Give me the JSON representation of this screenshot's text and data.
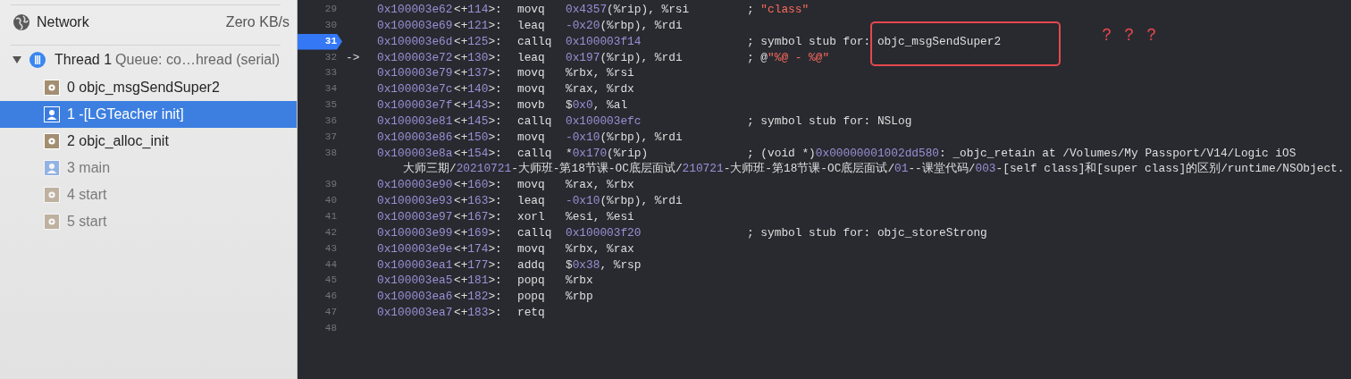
{
  "sidebar": {
    "network": {
      "label": "Network",
      "value": "Zero KB/s"
    },
    "thread": {
      "expanded": true,
      "name": "Thread 1",
      "queue": "Queue: co…hread (serial)",
      "frames": [
        {
          "label": "0 objc_msgSendSuper2",
          "kind": "library",
          "dimmed": false,
          "selected": false
        },
        {
          "label": "1 -[LGTeacher init]",
          "kind": "user",
          "dimmed": false,
          "selected": true
        },
        {
          "label": "2 objc_alloc_init",
          "kind": "library",
          "dimmed": false,
          "selected": false
        },
        {
          "label": "3 main",
          "kind": "user",
          "dimmed": true,
          "selected": false
        },
        {
          "label": "4 start",
          "kind": "library",
          "dimmed": true,
          "selected": false
        },
        {
          "label": "5 start",
          "kind": "library",
          "dimmed": true,
          "selected": false
        }
      ]
    }
  },
  "disassembly": {
    "lines": [
      {
        "num": "29",
        "breakpoint": false,
        "address": "0x100003e62",
        "offset": [
          {
            "text": "<+",
            "kind": "plain"
          },
          {
            "text": "114",
            "kind": "num"
          },
          {
            "text": ">:",
            "kind": "plain"
          }
        ],
        "mnemonic": "movq",
        "operand": [
          {
            "text": "0x4357",
            "kind": "num"
          },
          {
            "text": "(%rip), %rsi",
            "kind": "plain"
          }
        ],
        "comment": [
          {
            "text": "; ",
            "kind": "plain"
          },
          {
            "text": "\"class\"",
            "kind": "str"
          }
        ]
      },
      {
        "num": "30",
        "breakpoint": false,
        "address": "0x100003e69",
        "offset": [
          {
            "text": "<+",
            "kind": "plain"
          },
          {
            "text": "121",
            "kind": "num"
          },
          {
            "text": ">:",
            "kind": "plain"
          }
        ],
        "mnemonic": "leaq",
        "operand": [
          {
            "text": "-0x20",
            "kind": "num"
          },
          {
            "text": "(%rbp), %rdi",
            "kind": "plain"
          }
        ]
      },
      {
        "num": "31",
        "breakpoint": true,
        "address": "0x100003e6d",
        "offset": [
          {
            "text": "<+",
            "kind": "plain"
          },
          {
            "text": "125",
            "kind": "num"
          },
          {
            "text": ">:",
            "kind": "plain"
          }
        ],
        "mnemonic": "callq",
        "operand": [
          {
            "text": "0x100003f14",
            "kind": "num"
          }
        ],
        "comment": [
          {
            "text": "; symbol stub for: objc_msgSendSuper2",
            "kind": "plain"
          }
        ]
      },
      {
        "num": "32",
        "breakpoint": false,
        "arrow": "->",
        "address": "0x100003e72",
        "offset": [
          {
            "text": "<+",
            "kind": "plain"
          },
          {
            "text": "130",
            "kind": "num"
          },
          {
            "text": ">:",
            "kind": "plain"
          }
        ],
        "mnemonic": "leaq",
        "operand": [
          {
            "text": "0x197",
            "kind": "num"
          },
          {
            "text": "(%rip), %rdi",
            "kind": "plain"
          }
        ],
        "comment": [
          {
            "text": "; @",
            "kind": "plain"
          },
          {
            "text": "\"%@ - %@\"",
            "kind": "str"
          }
        ]
      },
      {
        "num": "33",
        "breakpoint": false,
        "address": "0x100003e79",
        "offset": [
          {
            "text": "<+",
            "kind": "plain"
          },
          {
            "text": "137",
            "kind": "num"
          },
          {
            "text": ">:",
            "kind": "plain"
          }
        ],
        "mnemonic": "movq",
        "operand": [
          {
            "text": "%rbx, %rsi",
            "kind": "plain"
          }
        ]
      },
      {
        "num": "34",
        "breakpoint": false,
        "address": "0x100003e7c",
        "offset": [
          {
            "text": "<+",
            "kind": "plain"
          },
          {
            "text": "140",
            "kind": "num"
          },
          {
            "text": ">:",
            "kind": "plain"
          }
        ],
        "mnemonic": "movq",
        "operand": [
          {
            "text": "%rax, %rdx",
            "kind": "plain"
          }
        ]
      },
      {
        "num": "35",
        "breakpoint": false,
        "address": "0x100003e7f",
        "offset": [
          {
            "text": "<+",
            "kind": "plain"
          },
          {
            "text": "143",
            "kind": "num"
          },
          {
            "text": ">:",
            "kind": "plain"
          }
        ],
        "mnemonic": "movb",
        "operand": [
          {
            "text": "$",
            "kind": "plain"
          },
          {
            "text": "0x0",
            "kind": "num"
          },
          {
            "text": ", %al",
            "kind": "plain"
          }
        ]
      },
      {
        "num": "36",
        "breakpoint": false,
        "address": "0x100003e81",
        "offset": [
          {
            "text": "<+",
            "kind": "plain"
          },
          {
            "text": "145",
            "kind": "num"
          },
          {
            "text": ">:",
            "kind": "plain"
          }
        ],
        "mnemonic": "callq",
        "operand": [
          {
            "text": "0x100003efc",
            "kind": "num"
          }
        ],
        "comment": [
          {
            "text": "; symbol stub for: NSLog",
            "kind": "plain"
          }
        ]
      },
      {
        "num": "37",
        "breakpoint": false,
        "address": "0x100003e86",
        "offset": [
          {
            "text": "<+",
            "kind": "plain"
          },
          {
            "text": "150",
            "kind": "num"
          },
          {
            "text": ">:",
            "kind": "plain"
          }
        ],
        "mnemonic": "movq",
        "operand": [
          {
            "text": "-0x10",
            "kind": "num"
          },
          {
            "text": "(%rbp), %rdi",
            "kind": "plain"
          }
        ]
      },
      {
        "num": "38",
        "breakpoint": false,
        "address": "0x100003e8a",
        "offset": [
          {
            "text": "<+",
            "kind": "plain"
          },
          {
            "text": "154",
            "kind": "num"
          },
          {
            "text": ">:",
            "kind": "plain"
          }
        ],
        "mnemonic": "callq",
        "operand": [
          {
            "text": "*",
            "kind": "plain"
          },
          {
            "text": "0x170",
            "kind": "num"
          },
          {
            "text": "(%rip)",
            "kind": "plain"
          }
        ],
        "comment": [
          {
            "text": "; (void *)",
            "kind": "plain"
          },
          {
            "text": "0x00000001002dd580",
            "kind": "num"
          },
          {
            "text": ": _objc_retain at /Volumes/My Passport/V14/Logic iOS",
            "kind": "plain"
          }
        ],
        "continuation": [
          {
            "text": "大师三期/",
            "kind": "plain"
          },
          {
            "text": "20210721",
            "kind": "num"
          },
          {
            "text": "-大师班-第18节课-OC底层面试/",
            "kind": "plain"
          },
          {
            "text": "210721",
            "kind": "num"
          },
          {
            "text": "-大师班-第18节课-OC底层面试/",
            "kind": "plain"
          },
          {
            "text": "01",
            "kind": "num"
          },
          {
            "text": "--课堂代码/",
            "kind": "plain"
          },
          {
            "text": "003",
            "kind": "num"
          },
          {
            "text": "-[self class]和[super class]的区别/runtime/NSObject.",
            "kind": "plain"
          }
        ]
      },
      {
        "num": "39",
        "breakpoint": false,
        "address": "0x100003e90",
        "offset": [
          {
            "text": "<+",
            "kind": "plain"
          },
          {
            "text": "160",
            "kind": "num"
          },
          {
            "text": ">:",
            "kind": "plain"
          }
        ],
        "mnemonic": "movq",
        "operand": [
          {
            "text": "%rax, %rbx",
            "kind": "plain"
          }
        ]
      },
      {
        "num": "40",
        "breakpoint": false,
        "address": "0x100003e93",
        "offset": [
          {
            "text": "<+",
            "kind": "plain"
          },
          {
            "text": "163",
            "kind": "num"
          },
          {
            "text": ">:",
            "kind": "plain"
          }
        ],
        "mnemonic": "leaq",
        "operand": [
          {
            "text": "-0x10",
            "kind": "num"
          },
          {
            "text": "(%rbp), %rdi",
            "kind": "plain"
          }
        ]
      },
      {
        "num": "41",
        "breakpoint": false,
        "address": "0x100003e97",
        "offset": [
          {
            "text": "<+",
            "kind": "plain"
          },
          {
            "text": "167",
            "kind": "num"
          },
          {
            "text": ">:",
            "kind": "plain"
          }
        ],
        "mnemonic": "xorl",
        "operand": [
          {
            "text": "%esi, %esi",
            "kind": "plain"
          }
        ]
      },
      {
        "num": "42",
        "breakpoint": false,
        "address": "0x100003e99",
        "offset": [
          {
            "text": "<+",
            "kind": "plain"
          },
          {
            "text": "169",
            "kind": "num"
          },
          {
            "text": ">:",
            "kind": "plain"
          }
        ],
        "mnemonic": "callq",
        "operand": [
          {
            "text": "0x100003f20",
            "kind": "num"
          }
        ],
        "comment": [
          {
            "text": "; symbol stub for: objc_storeStrong",
            "kind": "plain"
          }
        ]
      },
      {
        "num": "43",
        "breakpoint": false,
        "address": "0x100003e9e",
        "offset": [
          {
            "text": "<+",
            "kind": "plain"
          },
          {
            "text": "174",
            "kind": "num"
          },
          {
            "text": ">:",
            "kind": "plain"
          }
        ],
        "mnemonic": "movq",
        "operand": [
          {
            "text": "%rbx, %rax",
            "kind": "plain"
          }
        ]
      },
      {
        "num": "44",
        "breakpoint": false,
        "address": "0x100003ea1",
        "offset": [
          {
            "text": "<+",
            "kind": "plain"
          },
          {
            "text": "177",
            "kind": "num"
          },
          {
            "text": ">:",
            "kind": "plain"
          }
        ],
        "mnemonic": "addq",
        "operand": [
          {
            "text": "$",
            "kind": "plain"
          },
          {
            "text": "0x38",
            "kind": "num"
          },
          {
            "text": ", %rsp",
            "kind": "plain"
          }
        ]
      },
      {
        "num": "45",
        "breakpoint": false,
        "address": "0x100003ea5",
        "offset": [
          {
            "text": "<+",
            "kind": "plain"
          },
          {
            "text": "181",
            "kind": "num"
          },
          {
            "text": ">:",
            "kind": "plain"
          }
        ],
        "mnemonic": "popq",
        "operand": [
          {
            "text": "%rbx",
            "kind": "plain"
          }
        ]
      },
      {
        "num": "46",
        "breakpoint": false,
        "address": "0x100003ea6",
        "offset": [
          {
            "text": "<+",
            "kind": "plain"
          },
          {
            "text": "182",
            "kind": "num"
          },
          {
            "text": ">:",
            "kind": "plain"
          }
        ],
        "mnemonic": "popq",
        "operand": [
          {
            "text": "%rbp",
            "kind": "plain"
          }
        ]
      },
      {
        "num": "47",
        "breakpoint": false,
        "address": "0x100003ea7",
        "offset": [
          {
            "text": "<+",
            "kind": "plain"
          },
          {
            "text": "183",
            "kind": "num"
          },
          {
            "text": ">:",
            "kind": "plain"
          }
        ],
        "mnemonic": "retq"
      },
      {
        "num": "48",
        "breakpoint": false
      }
    ],
    "annotation": {
      "note": "？ ？ ？"
    }
  }
}
